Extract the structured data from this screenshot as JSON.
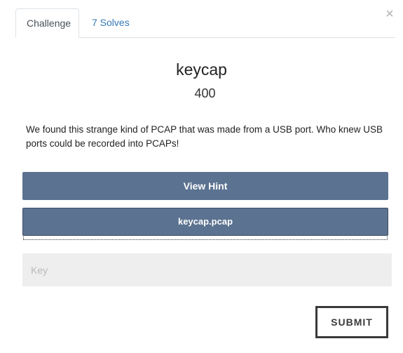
{
  "modal": {
    "close_glyph": "×",
    "close_icon": "close-icon"
  },
  "tabs": [
    {
      "label": "Challenge",
      "active": true
    },
    {
      "label": "7 Solves",
      "active": false
    }
  ],
  "challenge": {
    "name": "keycap",
    "value": "400",
    "description": "We found this strange kind of PCAP that was made from a USB port. Who knew USB ports could be recorded into PCAPs!"
  },
  "buttons": {
    "hint_label": "View Hint",
    "file_label": "keycap.pcap",
    "submit_label": "SUBMIT"
  },
  "key_input": {
    "value": "",
    "placeholder": "Key"
  },
  "colors": {
    "button_bg": "#5b7290",
    "tab_link": "#337ab7",
    "input_bg": "#eeeeee"
  }
}
